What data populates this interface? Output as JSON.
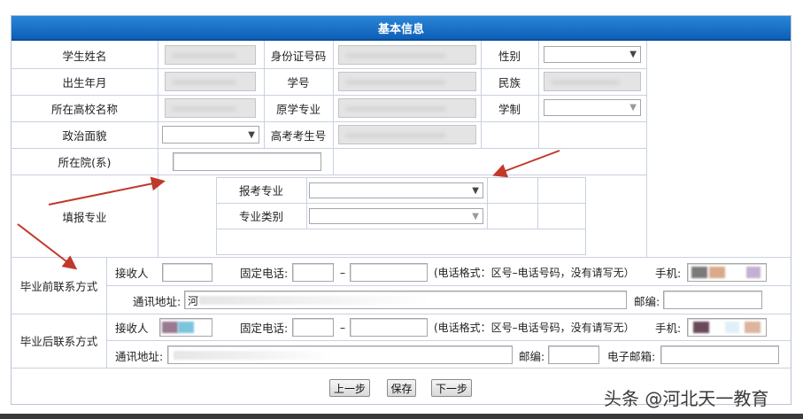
{
  "header": {
    "title": "基本信息"
  },
  "labels": {
    "student_name": "学生姓名",
    "id_number": "身份证号码",
    "gender": "性别",
    "birth": "出生年月",
    "student_no": "学号",
    "ethnicity": "民族",
    "school": "所在高校名称",
    "original_major": "原学专业",
    "duration": "学制",
    "political": "政治面貌",
    "exam_no": "高考考生号",
    "department": "所在院(系)",
    "apply_major": "填报专业",
    "apply_major_sub": "报考专业",
    "major_type": "专业类别",
    "pre_contact": "毕业前联系方式",
    "post_contact": "毕业后联系方式",
    "receiver": "接收人",
    "phone": "固定电话:",
    "phone_dash": "–",
    "phone_hint": "(电话格式：区号–电话号码，没有请写无）",
    "mobile": "手机:",
    "address": "通讯地址:",
    "post_address_label": "通讯地址:",
    "zip": "邮编:",
    "post_zip": "邮编:",
    "email": "电子邮箱:",
    "address_prefix": "河"
  },
  "selects": {
    "arrow": "▼"
  },
  "buttons": {
    "prev": "上一步",
    "save": "保存",
    "next": "下一步"
  },
  "watermark": "头条 @河北天一教育",
  "colors": {
    "header": "#1e78cc",
    "grid": "#c8d2e0",
    "arrow": "#c0392b"
  }
}
